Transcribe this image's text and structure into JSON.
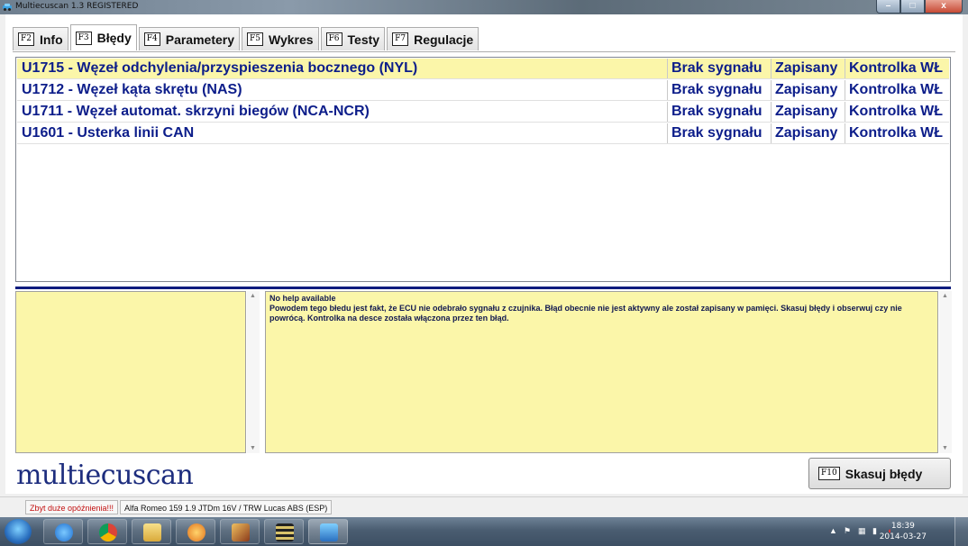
{
  "window": {
    "title": "Multiecuscan 1.3 REGISTERED",
    "controls": [
      "–",
      "□",
      "x"
    ]
  },
  "tabs": [
    {
      "key": "F2",
      "label": "Info",
      "active": false
    },
    {
      "key": "F3",
      "label": "Błędy",
      "active": true
    },
    {
      "key": "F4",
      "label": "Parametery",
      "active": false
    },
    {
      "key": "F5",
      "label": "Wykres",
      "active": false
    },
    {
      "key": "F6",
      "label": "Testy",
      "active": false
    },
    {
      "key": "F7",
      "label": "Regulacje",
      "active": false
    }
  ],
  "errors": [
    {
      "desc": "U1715 - Węzeł odchylenia/przyspieszenia bocznego (NYL)",
      "status": "Brak sygnału",
      "stored": "Zapisany",
      "lamp": "Kontrolka WŁ",
      "selected": true
    },
    {
      "desc": "U1712 - Węzeł kąta skrętu (NAS)",
      "status": "Brak sygnału",
      "stored": "Zapisany",
      "lamp": "Kontrolka WŁ",
      "selected": false
    },
    {
      "desc": "U1711 - Węzeł automat. skrzyni biegów (NCA-NCR)",
      "status": "Brak sygnału",
      "stored": "Zapisany",
      "lamp": "Kontrolka WŁ",
      "selected": false
    },
    {
      "desc": "U1601 - Usterka linii CAN",
      "status": "Brak sygnału",
      "stored": "Zapisany",
      "lamp": "Kontrolka WŁ",
      "selected": false
    }
  ],
  "help": {
    "line1": "No help available",
    "body": "Powodem tego błedu jest fakt, że ECU nie odebrało sygnału z czujnika. Błąd obecnie nie jest aktywny ale został zapisany w pamięci. Skasuj błędy i obserwuj czy nie powrócą. Kontrolka na desce została włączona przez ten błąd."
  },
  "logo": "multiecuscan",
  "clear_button": {
    "key": "F10",
    "label": "Skasuj błędy"
  },
  "statusbar": {
    "warning": "Zbyt duże opóźnienia!!!",
    "vehicle": "Alfa Romeo 159 1.9 JTDm 16V / TRW Lucas ABS (ESP)"
  },
  "taskbar": {
    "clock_time": "18:39",
    "clock_date": "2014-03-27",
    "apps": [
      "windows-explorer-ie",
      "chrome",
      "file-explorer",
      "media-player",
      "tool-app",
      "film-app",
      "multiecuscan-app"
    ]
  },
  "colors": {
    "selection": "#fbf6a9",
    "list_text": "#0c1d8a",
    "divider": "#0f1c7e",
    "warning": "#c21010"
  }
}
